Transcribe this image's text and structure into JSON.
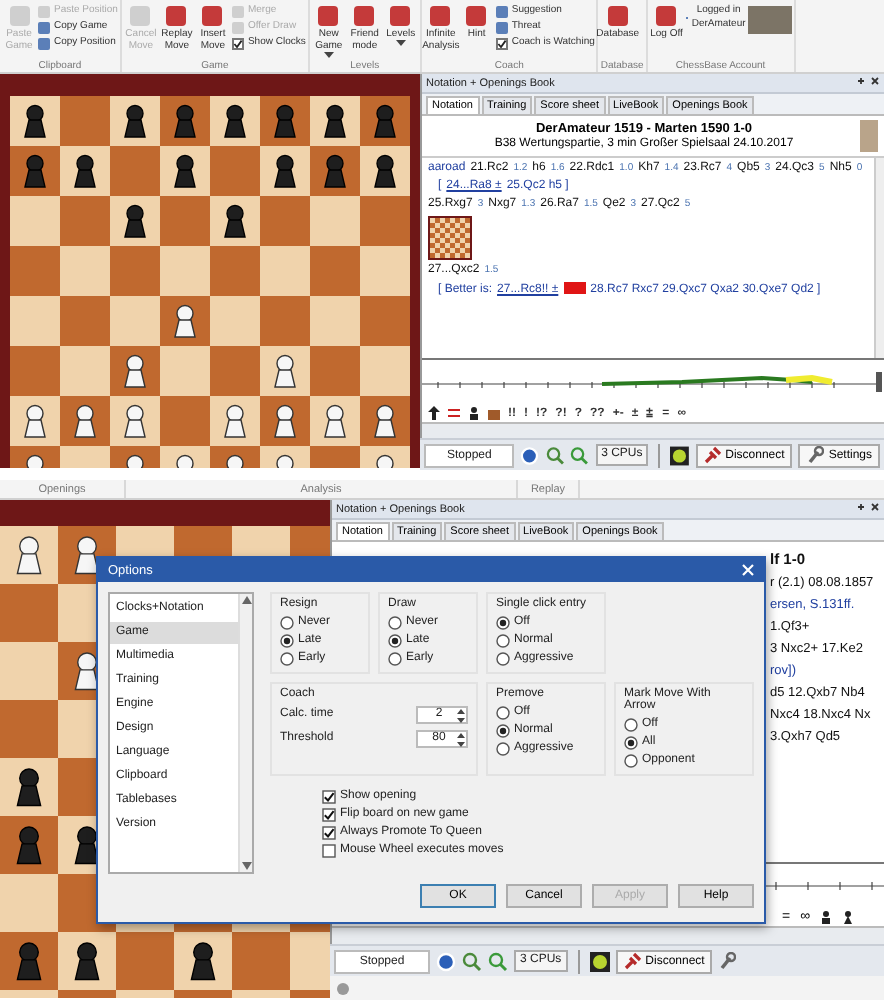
{
  "top": {
    "ribbon": {
      "groups": [
        {
          "label": "Clipboard",
          "items": [
            {
              "kind": "large",
              "label": "Paste Game",
              "disabled": true,
              "dropdown": false
            },
            {
              "kind": "small",
              "label": "Paste Position",
              "disabled": true,
              "dropdown": false
            },
            {
              "kind": "small",
              "label": "Copy Game",
              "disabled": false,
              "dropdown": false
            },
            {
              "kind": "small",
              "label": "Copy Position",
              "disabled": false,
              "dropdown": false
            }
          ]
        },
        {
          "label": "Game",
          "items": [
            {
              "kind": "large",
              "label": "Cancel Move",
              "disabled": true,
              "dropdown": false
            },
            {
              "kind": "large",
              "label": "Replay Move",
              "disabled": false,
              "dropdown": false
            },
            {
              "kind": "large",
              "label": "Insert Move",
              "disabled": false,
              "dropdown": false
            },
            {
              "kind": "small",
              "label": "Merge",
              "disabled": true,
              "dropdown": false
            },
            {
              "kind": "small",
              "label": "Offer Draw",
              "disabled": true,
              "dropdown": false
            },
            {
              "kind": "check",
              "label": "Show Clocks",
              "disabled": false,
              "dropdown": false,
              "checked": true
            }
          ]
        },
        {
          "label": "Levels",
          "items": [
            {
              "kind": "large",
              "label": "New Game",
              "disabled": false,
              "dropdown": true
            },
            {
              "kind": "large",
              "label": "Friend mode",
              "disabled": false,
              "dropdown": false
            },
            {
              "kind": "large",
              "label": "Levels",
              "disabled": false,
              "dropdown": true
            }
          ]
        },
        {
          "label": "Coach",
          "items": [
            {
              "kind": "large",
              "label": "Infinite Analysis",
              "disabled": false,
              "dropdown": false
            },
            {
              "kind": "large",
              "label": "Hint",
              "disabled": false,
              "dropdown": false
            },
            {
              "kind": "small",
              "label": "Suggestion",
              "disabled": false,
              "dropdown": false
            },
            {
              "kind": "small",
              "label": "Threat",
              "disabled": false,
              "dropdown": false
            },
            {
              "kind": "check",
              "label": "Coach is Watching",
              "disabled": false,
              "dropdown": false,
              "checked": true
            }
          ]
        },
        {
          "label": "Database",
          "items": [
            {
              "kind": "large",
              "label": "Database",
              "disabled": false,
              "dropdown": false
            }
          ]
        },
        {
          "label": "ChessBase Account",
          "photo": true,
          "items": [
            {
              "kind": "large",
              "label": "Log Off",
              "disabled": false,
              "dropdown": false
            },
            {
              "kind": "small",
              "label": "Logged in DerAmateur",
              "disabled": false,
              "dropdown": false
            }
          ]
        }
      ]
    },
    "notation": {
      "title": "Notation + Openings Book",
      "tabs": [
        {
          "label": "Notation",
          "selected": true
        },
        {
          "label": "Training",
          "selected": false
        },
        {
          "label": "Score sheet",
          "selected": false
        },
        {
          "label": "LiveBook",
          "selected": false
        },
        {
          "label": "Openings Book",
          "selected": false
        }
      ],
      "game_header": [
        "DerAmateur 1519 - Marten 1590  1-0",
        "B38 Wertungspartie, 3 min Großer Spielsaal 24.10.2017"
      ],
      "lines": [
        {
          "kind": "main",
          "tokens": [
            {
              "kind": "name",
              "text": "aaroad"
            },
            {
              "kind": "move",
              "text": "21.Rc2"
            },
            {
              "kind": "time",
              "text": "1.2"
            },
            {
              "kind": "move",
              "text": "h6"
            },
            {
              "kind": "time",
              "text": "1.6"
            },
            {
              "kind": "move",
              "text": "22.Rdc1"
            },
            {
              "kind": "time",
              "text": "1.0"
            },
            {
              "kind": "move",
              "text": "Kh7"
            },
            {
              "kind": "time",
              "text": "1.4"
            },
            {
              "kind": "move",
              "text": "23.Rc7"
            },
            {
              "kind": "time",
              "text": "4"
            },
            {
              "kind": "move",
              "text": "Qb5"
            },
            {
              "kind": "time",
              "text": "3"
            },
            {
              "kind": "move",
              "text": "24.Qc3"
            },
            {
              "kind": "time",
              "text": "5"
            },
            {
              "kind": "move",
              "text": "Nh5"
            },
            {
              "kind": "time",
              "text": "0"
            }
          ]
        },
        {
          "kind": "variation",
          "tokens": [
            {
              "kind": "var",
              "text": "["
            },
            {
              "kind": "link",
              "text": "24...Ra8 ±"
            },
            {
              "kind": "var",
              "text": "25.Qc2  h5 ]"
            }
          ]
        },
        {
          "kind": "main",
          "tokens": [
            {
              "kind": "move",
              "text": "25.Rxg7"
            },
            {
              "kind": "time",
              "text": "3"
            },
            {
              "kind": "move",
              "text": "Nxg7"
            },
            {
              "kind": "time",
              "text": "1.3"
            },
            {
              "kind": "move",
              "text": "26.Ra7"
            },
            {
              "kind": "time",
              "text": "1.5"
            },
            {
              "kind": "move",
              "text": "Qe2"
            },
            {
              "kind": "time",
              "text": "3"
            },
            {
              "kind": "move",
              "text": "27.Qc2"
            },
            {
              "kind": "time",
              "text": "5"
            }
          ]
        },
        {
          "kind": "diagram"
        },
        {
          "kind": "main",
          "tokens": [
            {
              "kind": "move",
              "text": "27...Qxc2"
            },
            {
              "kind": "time",
              "text": "1.5"
            }
          ]
        },
        {
          "kind": "variation",
          "tokens": [
            {
              "kind": "var",
              "text": "[ Better is:"
            },
            {
              "kind": "link",
              "text": "27...Rc8!! ±"
            },
            {
              "kind": "highlight"
            },
            {
              "kind": "var",
              "text": "28.Rc7  Rxc7  29.Qxc7  Qxa2  30.Qxe7  Qd2 ]"
            }
          ]
        }
      ],
      "annotation_symbols": [
        "!!",
        "!",
        "!?",
        "?!",
        "?",
        "??",
        "+-",
        "±",
        "⩲",
        "=",
        "∞"
      ]
    },
    "engine": {
      "status": "Stopped",
      "cpus": "3 CPUs",
      "buttons": [
        {
          "kind": "disconnect",
          "label": "Disconnect"
        },
        {
          "kind": "settings",
          "label": "Settings"
        }
      ]
    }
  },
  "bottom": {
    "ribbon_groups": [
      "Openings",
      "Analysis",
      "Replay"
    ],
    "notation": {
      "title": "Notation + Openings Book",
      "tabs": [
        {
          "label": "Notation",
          "selected": true
        },
        {
          "label": "Training",
          "selected": false
        },
        {
          "label": "Score sheet",
          "selected": false
        },
        {
          "label": "LiveBook",
          "selected": false
        },
        {
          "label": "Openings Book",
          "selected": false
        }
      ],
      "lines": [
        {
          "kind": "header",
          "text": "lf 1-0"
        },
        {
          "kind": "header",
          "text": "r (2.1) 08.08.1857"
        },
        {
          "kind": "source",
          "text": "ersen, S.131ff."
        },
        {
          "kind": "moves",
          "text": "1.Qf3+"
        },
        {
          "kind": "moves",
          "text": "3  Nxc2+  17.Ke2"
        },
        {
          "kind": "source",
          "text": "rov])"
        },
        {
          "kind": "moves",
          "text": "d5  12.Qxb7  Nb4"
        },
        {
          "kind": "moves",
          "text": "Nxc4  18.Nxc4  Nx"
        },
        {
          "kind": "moves",
          "text": "3.Qxh7  Qd5"
        }
      ],
      "annotation_symbols": [
        "=",
        "∞"
      ]
    },
    "engine": {
      "status": "Stopped",
      "cpus": "3 CPUs",
      "buttons": [
        {
          "kind": "disconnect",
          "label": "Disconnect"
        },
        {
          "kind": "settings"
        }
      ]
    },
    "dialog": {
      "title": "Options",
      "categories": [
        {
          "label": "Clocks+Notation",
          "selected": false
        },
        {
          "label": "Game",
          "selected": true
        },
        {
          "label": "Multimedia",
          "selected": false
        },
        {
          "label": "Training",
          "selected": false
        },
        {
          "label": "Engine",
          "selected": false
        },
        {
          "label": "Design",
          "selected": false
        },
        {
          "label": "Language",
          "selected": false
        },
        {
          "label": "Clipboard",
          "selected": false
        },
        {
          "label": "Tablebases",
          "selected": false
        },
        {
          "label": "Version",
          "selected": false
        }
      ],
      "groups": [
        {
          "kind": "radio",
          "title": "Resign",
          "options": [
            {
              "label": "Never",
              "selected": false
            },
            {
              "label": "Late",
              "selected": true
            },
            {
              "label": "Early",
              "selected": false
            }
          ]
        },
        {
          "kind": "radio",
          "title": "Draw",
          "options": [
            {
              "label": "Never",
              "selected": false
            },
            {
              "label": "Late",
              "selected": true
            },
            {
              "label": "Early",
              "selected": false
            }
          ]
        },
        {
          "kind": "radio",
          "title": "Single click entry",
          "options": [
            {
              "label": "Off",
              "selected": true
            },
            {
              "label": "Normal",
              "selected": false
            },
            {
              "label": "Aggressive",
              "selected": false
            }
          ]
        },
        {
          "kind": "spin",
          "title": "Coach",
          "fields": [
            {
              "label": "Calc. time",
              "value": "2"
            },
            {
              "label": "Threshold",
              "value": "80"
            }
          ]
        },
        {
          "kind": "radio",
          "title": "Premove",
          "options": [
            {
              "label": "Off",
              "selected": false
            },
            {
              "label": "Normal",
              "selected": true
            },
            {
              "label": "Aggressive",
              "selected": false
            }
          ]
        },
        {
          "kind": "radio",
          "title": "Mark Move With Arrow",
          "options": [
            {
              "label": "Off",
              "selected": false
            },
            {
              "label": "All",
              "selected": true
            },
            {
              "label": "Opponent",
              "selected": false
            }
          ]
        }
      ],
      "checkboxes": [
        {
          "label": "Show opening",
          "checked": true
        },
        {
          "label": "Flip board on new game",
          "checked": true
        },
        {
          "label": "Always Promote To Queen",
          "checked": true
        },
        {
          "label": "Mouse Wheel executes moves",
          "checked": false
        }
      ],
      "buttons": [
        {
          "label": "OK",
          "disabled": false
        },
        {
          "label": "Cancel",
          "disabled": false
        },
        {
          "label": "Apply",
          "disabled": true
        },
        {
          "label": "Help",
          "disabled": false
        }
      ]
    }
  }
}
